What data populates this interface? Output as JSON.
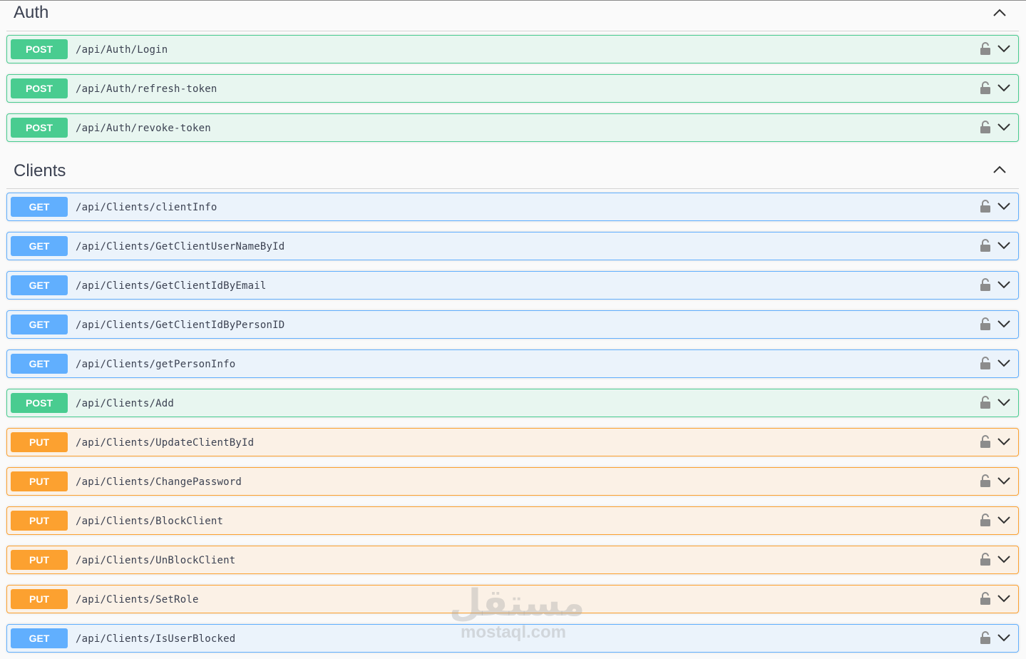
{
  "sections": [
    {
      "title": "Auth",
      "operations": [
        {
          "method": "POST",
          "path": "/api/Auth/Login"
        },
        {
          "method": "POST",
          "path": "/api/Auth/refresh-token"
        },
        {
          "method": "POST",
          "path": "/api/Auth/revoke-token"
        }
      ]
    },
    {
      "title": "Clients",
      "operations": [
        {
          "method": "GET",
          "path": "/api/Clients/clientInfo"
        },
        {
          "method": "GET",
          "path": "/api/Clients/GetClientUserNameById"
        },
        {
          "method": "GET",
          "path": "/api/Clients/GetClientIdByEmail"
        },
        {
          "method": "GET",
          "path": "/api/Clients/GetClientIdByPersonID"
        },
        {
          "method": "GET",
          "path": "/api/Clients/getPersonInfo"
        },
        {
          "method": "POST",
          "path": "/api/Clients/Add"
        },
        {
          "method": "PUT",
          "path": "/api/Clients/UpdateClientById"
        },
        {
          "method": "PUT",
          "path": "/api/Clients/ChangePassword"
        },
        {
          "method": "PUT",
          "path": "/api/Clients/BlockClient"
        },
        {
          "method": "PUT",
          "path": "/api/Clients/UnBlockClient"
        },
        {
          "method": "PUT",
          "path": "/api/Clients/SetRole"
        },
        {
          "method": "GET",
          "path": "/api/Clients/IsUserBlocked"
        }
      ]
    }
  ],
  "colors": {
    "post": "#49cc90",
    "get": "#61affe",
    "put": "#fca130"
  },
  "icons": {
    "lock": "lock-icon",
    "expand": "chevron-down-icon",
    "collapse": "chevron-up-icon"
  },
  "watermark": {
    "arabic": "مستقل",
    "latin": "mostaql.com"
  }
}
